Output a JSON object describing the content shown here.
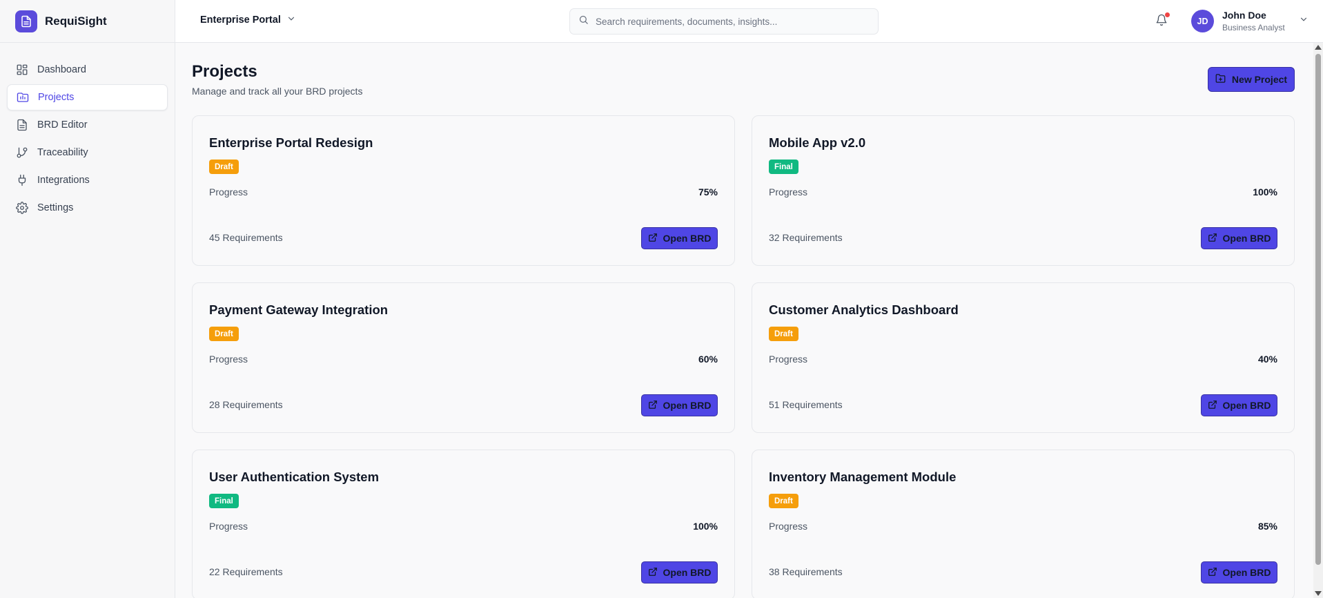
{
  "app": {
    "name": "RequiSight",
    "logo_icon": "document-icon"
  },
  "colors": {
    "accent": "#4f46e5",
    "draft": "#f59e0b",
    "final": "#10b981",
    "notification": "#ef4444"
  },
  "sidebar": {
    "items": [
      {
        "label": "Dashboard",
        "icon": "dashboard-icon",
        "active": false
      },
      {
        "label": "Projects",
        "icon": "folder-chart-icon",
        "active": true
      },
      {
        "label": "BRD Editor",
        "icon": "document-icon",
        "active": false
      },
      {
        "label": "Traceability",
        "icon": "git-branch-icon",
        "active": false
      },
      {
        "label": "Integrations",
        "icon": "plug-icon",
        "active": false
      },
      {
        "label": "Settings",
        "icon": "gear-icon",
        "active": false
      }
    ]
  },
  "topbar": {
    "portal": "Enterprise Portal",
    "search_placeholder": "Search requirements, documents, insights...",
    "search_value": "",
    "user": {
      "initials": "JD",
      "name": "John Doe",
      "role": "Business Analyst"
    }
  },
  "main": {
    "title": "Projects",
    "subtitle": "Manage and track all your BRD projects",
    "new_button": "New Project",
    "progress_label": "Progress",
    "open_button": "Open BRD",
    "projects": [
      {
        "title": "Enterprise Portal Redesign",
        "status": "Draft",
        "progress": "75%",
        "requirements": "45 Requirements"
      },
      {
        "title": "Mobile App v2.0",
        "status": "Final",
        "progress": "100%",
        "requirements": "32 Requirements"
      },
      {
        "title": "Payment Gateway Integration",
        "status": "Draft",
        "progress": "60%",
        "requirements": "28 Requirements"
      },
      {
        "title": "Customer Analytics Dashboard",
        "status": "Draft",
        "progress": "40%",
        "requirements": "51 Requirements"
      },
      {
        "title": "User Authentication System",
        "status": "Final",
        "progress": "100%",
        "requirements": "22 Requirements"
      },
      {
        "title": "Inventory Management Module",
        "status": "Draft",
        "progress": "85%",
        "requirements": "38 Requirements"
      }
    ]
  }
}
